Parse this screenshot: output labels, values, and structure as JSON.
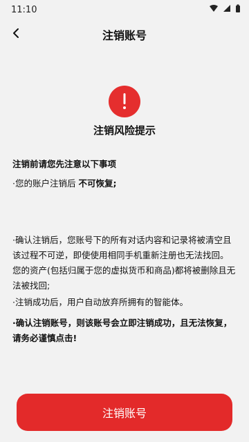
{
  "status_bar": {
    "time": "11:10"
  },
  "header": {
    "title": "注销账号"
  },
  "warning": {
    "title": "注销风险提示"
  },
  "notice": {
    "heading": "注销前请您先注意以下事项",
    "line1_prefix": "·您的账户注销后",
    "line1_emphasis": "不可恢复;",
    "line2": "·确认注销后，您账号下的所有对话内容和记录将被清空且该过程不可逆，即使使用相同手机重新注册也无法找回。您的资产(包括归属于您的虚拟货币和商品)都将被删除且无法被找回;",
    "line3": "·注销成功后，用户自动放弃所拥有的智能体。",
    "final_bold": "·确认注销账号，则该账号会立即注销成功，且无法恢复，请务必谨慎点击!"
  },
  "bottom_button": {
    "label": "注销账号",
    "color": "#e32a2a"
  }
}
